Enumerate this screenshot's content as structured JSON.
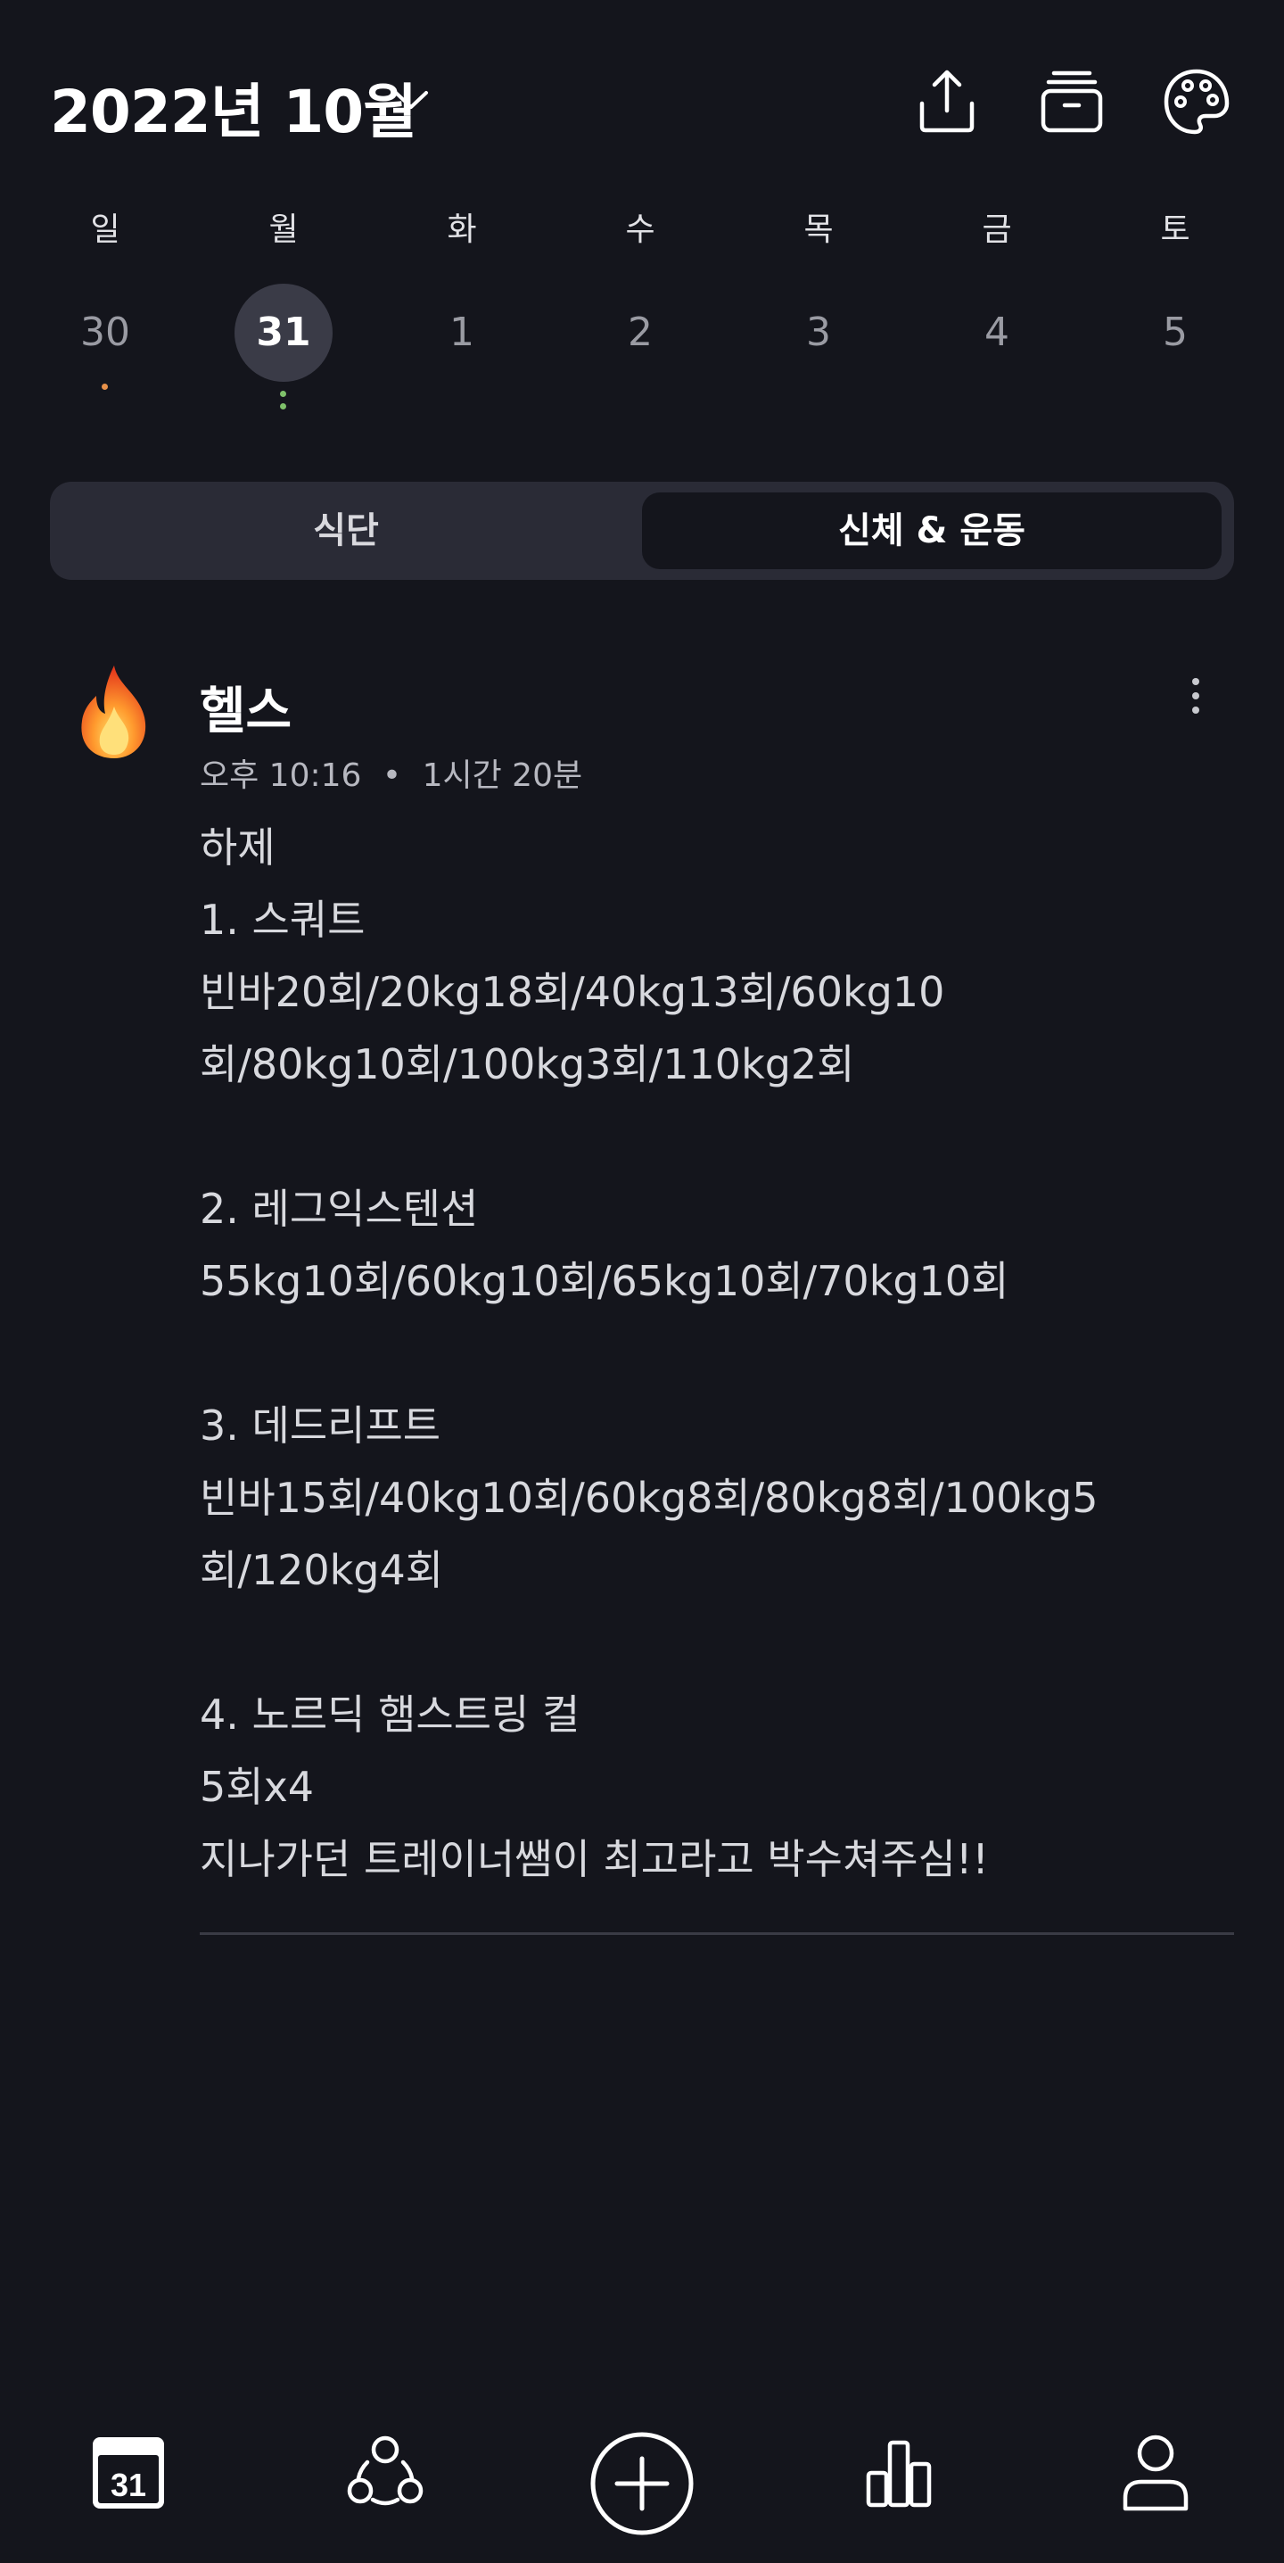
{
  "header": {
    "title": "2022년 10월",
    "icons": [
      "share-icon",
      "archive-icon",
      "palette-icon"
    ]
  },
  "week": {
    "weekdays": [
      "일",
      "월",
      "화",
      "수",
      "목",
      "금",
      "토"
    ],
    "days": [
      "30",
      "31",
      "1",
      "2",
      "3",
      "4",
      "5"
    ],
    "selected_index": 1
  },
  "tabs": {
    "diet": "식단",
    "body_exercise": "신체 & 운동",
    "active": "body_exercise"
  },
  "entry": {
    "icon": "fire-icon",
    "title": "헬스",
    "time": "오후 10:16",
    "separator": "•",
    "duration": "1시간 20분",
    "note": "하제\n1. 스쿼트\n빈바20회/20kg18회/40kg13회/60kg10회/80kg10회/100kg3회/110kg2회\n\n2. 레그익스텐션\n55kg10회/60kg10회/65kg10회/70kg10회\n\n3. 데드리프트\n빈바15회/40kg10회/60kg8회/80kg8회/100kg5회/120kg4회\n\n4. 노르딕 햄스트링 컬\n5회x4\n지나가던 트레이너쌤이 최고라고 박수쳐주심!!"
  },
  "bottom_nav": {
    "calendar_day": "31",
    "icons": [
      "calendar-icon",
      "community-icon",
      "add-icon",
      "stats-icon",
      "profile-icon"
    ]
  },
  "colors": {
    "background": "#14151c",
    "segment": "#2a2b36",
    "selected_day": "#3a3b47",
    "dot_orange": "#e8914a",
    "dot_green": "#7fc16a"
  }
}
